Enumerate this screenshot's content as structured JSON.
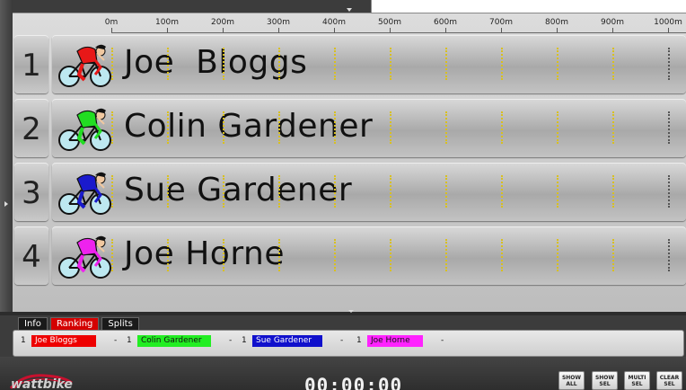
{
  "ruler": {
    "ticks": [
      "0m",
      "100m",
      "200m",
      "300m",
      "400m",
      "500m",
      "600m",
      "700m",
      "800m",
      "900m",
      "1000m"
    ]
  },
  "riders": [
    {
      "rank": "1",
      "name": "Joe  Bloggs",
      "color": "#e81818"
    },
    {
      "rank": "2",
      "name": "Colin Gardener",
      "color": "#22dd22"
    },
    {
      "rank": "3",
      "name": "Sue Gardener",
      "color": "#1a1acc"
    },
    {
      "rank": "4",
      "name": "Joe Horne",
      "color": "#ee22ee"
    }
  ],
  "tabs": [
    {
      "label": "Info",
      "active": false
    },
    {
      "label": "Ranking",
      "active": true
    },
    {
      "label": "Splits",
      "active": false
    }
  ],
  "ranking": [
    {
      "rank": "1",
      "name": "Joe  Bloggs",
      "color": "#ee0000",
      "text_color": "#ffffff",
      "dash": "-"
    },
    {
      "rank": "1",
      "name": "Colin Gardener",
      "color": "#22ee22",
      "text_color": "#111111",
      "dash": "-"
    },
    {
      "rank": "1",
      "name": "Sue Gardener",
      "color": "#1010cc",
      "text_color": "#ffffff",
      "dash": "-"
    },
    {
      "rank": "1",
      "name": "Joe Horne",
      "color": "#ff22ff",
      "text_color": "#111111",
      "dash": "-"
    }
  ],
  "footer": {
    "logo": "wattbike",
    "timer": "00:00:00",
    "buttons": [
      {
        "line1": "SHOW",
        "line2": "ALL"
      },
      {
        "line1": "SHOW",
        "line2": "SEL"
      },
      {
        "line1": "MULTI",
        "line2": "SEL"
      },
      {
        "line1": "CLEAR",
        "line2": "SEL"
      }
    ]
  }
}
